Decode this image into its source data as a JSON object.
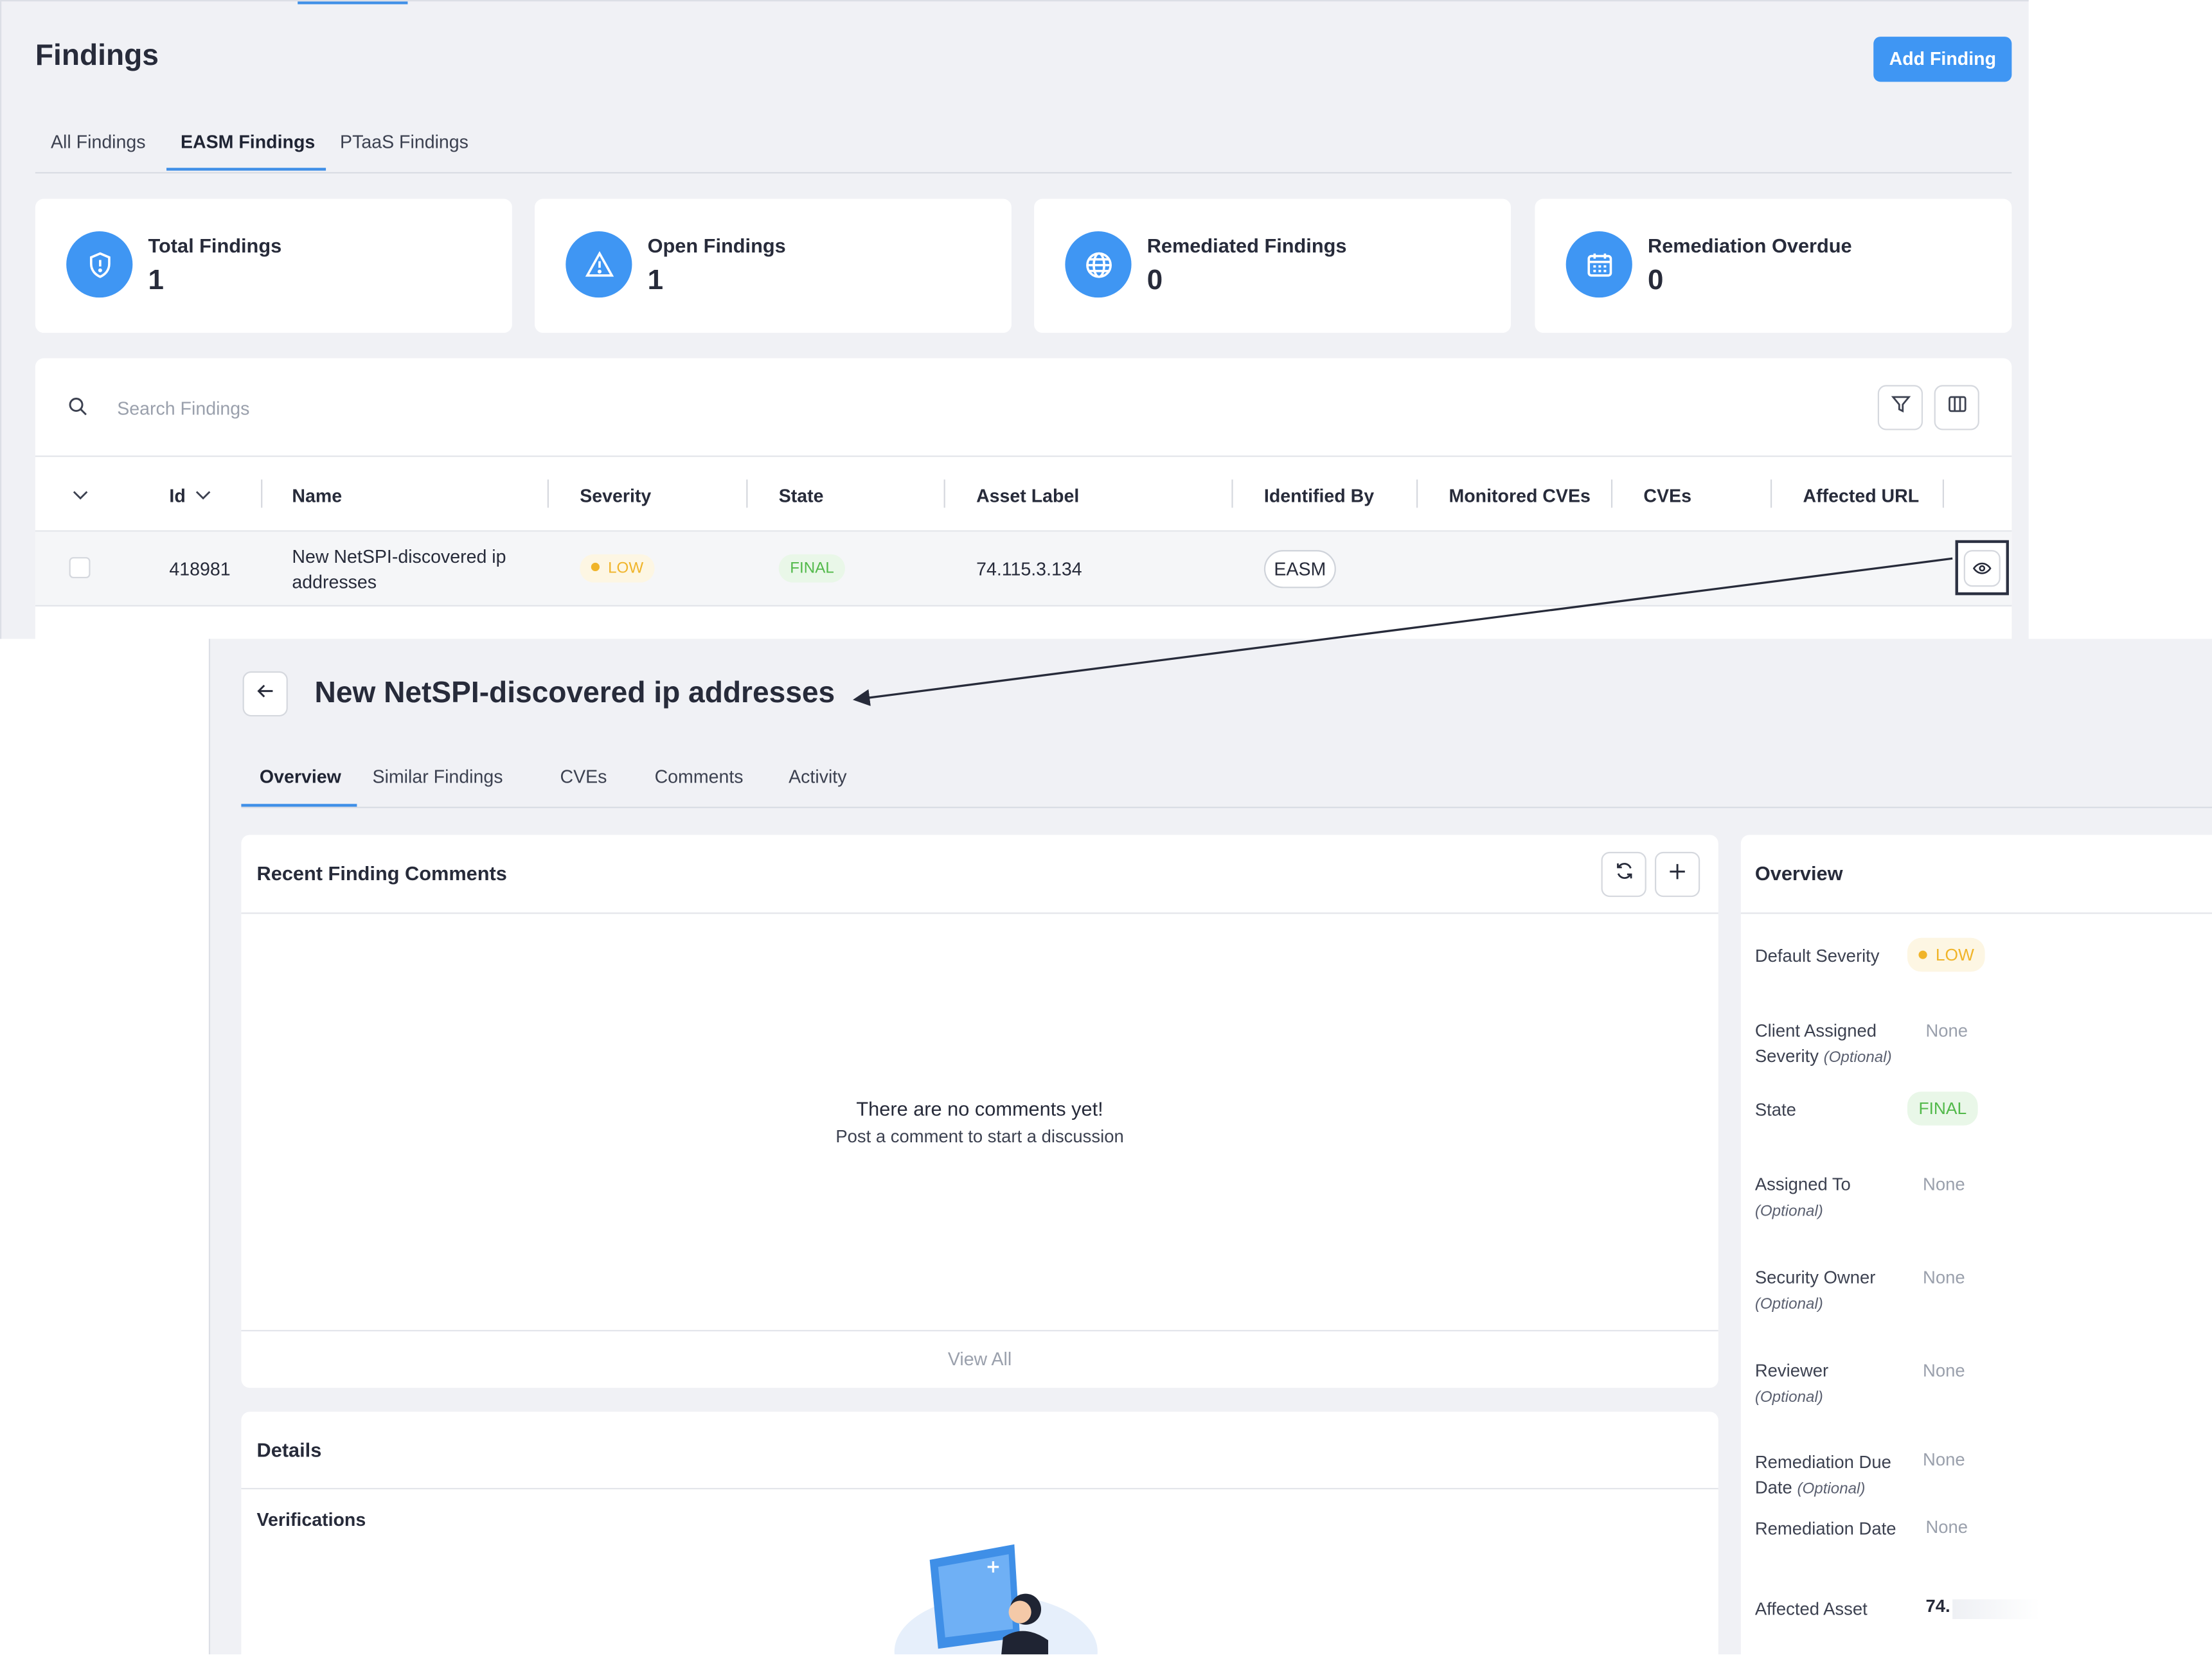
{
  "findings_page": {
    "title": "Findings",
    "add_button": "Add Finding",
    "tabs": [
      "All Findings",
      "EASM Findings",
      "PTaaS Findings"
    ],
    "active_tab": "EASM Findings",
    "stats": [
      {
        "label": "Total Findings",
        "value": "1",
        "icon": "shield-icon"
      },
      {
        "label": "Open Findings",
        "value": "1",
        "icon": "warning-icon"
      },
      {
        "label": "Remediated Findings",
        "value": "0",
        "icon": "globe-icon"
      },
      {
        "label": "Remediation Overdue",
        "value": "0",
        "icon": "calendar-icon"
      }
    ],
    "search_placeholder": "Search Findings",
    "columns": [
      "Id",
      "Name",
      "Severity",
      "State",
      "Asset Label",
      "Identified By",
      "Monitored CVEs",
      "CVEs",
      "Affected URL"
    ],
    "rows": [
      {
        "id": "418981",
        "name": "New NetSPI-discovered ip addresses",
        "severity": "LOW",
        "state": "FINAL",
        "asset_label": "74.115.3.134",
        "identified_by": "EASM"
      }
    ]
  },
  "detail_page": {
    "title": "New NetSPI-discovered ip addresses",
    "tabs": [
      "Overview",
      "Similar Findings",
      "CVEs",
      "Comments",
      "Activity"
    ],
    "active_tab": "Overview",
    "comments_card": {
      "title": "Recent Finding Comments",
      "empty_title": "There are no comments yet!",
      "empty_subtitle": "Post a comment to start a discussion",
      "view_all": "View All"
    },
    "details_card": {
      "title": "Details",
      "verifications": "Verifications"
    },
    "overview": {
      "title": "Overview",
      "optional_tag": "(Optional)",
      "default_severity_label": "Default Severity",
      "default_severity": "LOW",
      "client_severity_label_1": "Client Assigned",
      "client_severity_label_2": "Severity",
      "client_severity": "None",
      "state_label": "State",
      "state": "FINAL",
      "assigned_to_label": "Assigned To",
      "assigned_to": "None",
      "security_owner_label": "Security Owner",
      "security_owner": "None",
      "reviewer_label": "Reviewer",
      "reviewer": "None",
      "due_date_label_1": "Remediation Due",
      "due_date_label_2": "Date",
      "due_date": "None",
      "remediation_date_label": "Remediation Date",
      "remediation_date": "None",
      "affected_asset_label": "Affected Asset",
      "affected_asset": "74."
    }
  },
  "colors": {
    "accent": "#3f96f3",
    "low": "#f0b429",
    "final": "#52b94a",
    "background": "#f0f1f5"
  }
}
